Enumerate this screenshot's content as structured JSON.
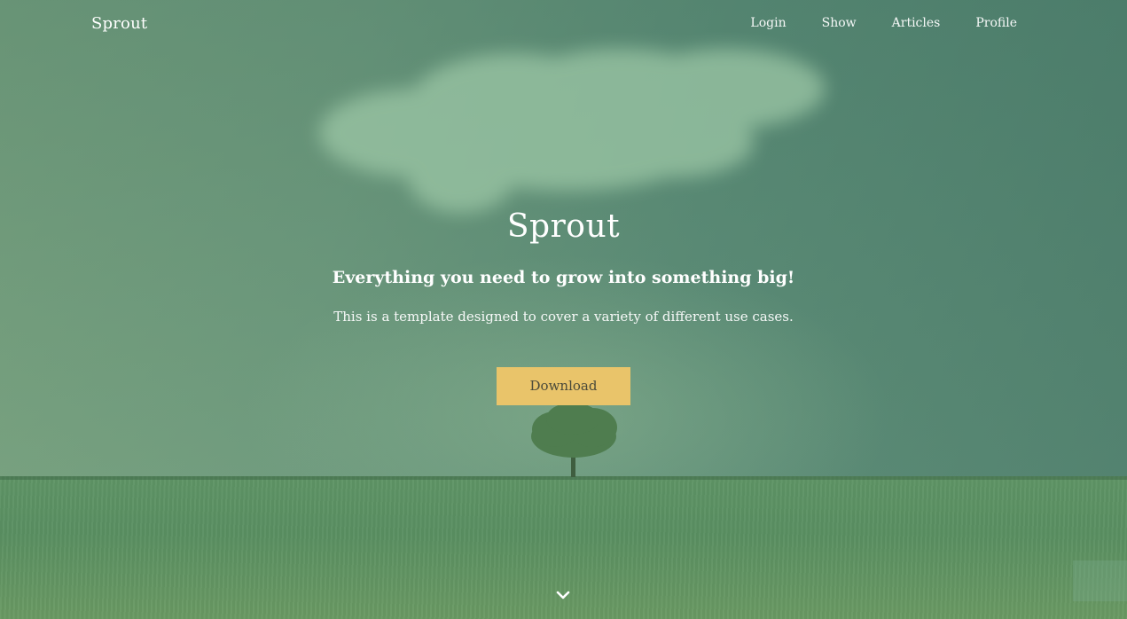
{
  "brand": "Sprout",
  "nav": {
    "items": [
      "Login",
      "Show",
      "Articles",
      "Profile"
    ]
  },
  "hero": {
    "title": "Sprout",
    "subtitle": "Everything you need to grow into something big!",
    "description": "This is a template designed to cover a variety of different use cases.",
    "button_label": "Download"
  },
  "colors": {
    "accent": "#e9c46a",
    "overlay": "#5a8a76"
  },
  "icons": {
    "scroll": "chevron-down-icon"
  }
}
